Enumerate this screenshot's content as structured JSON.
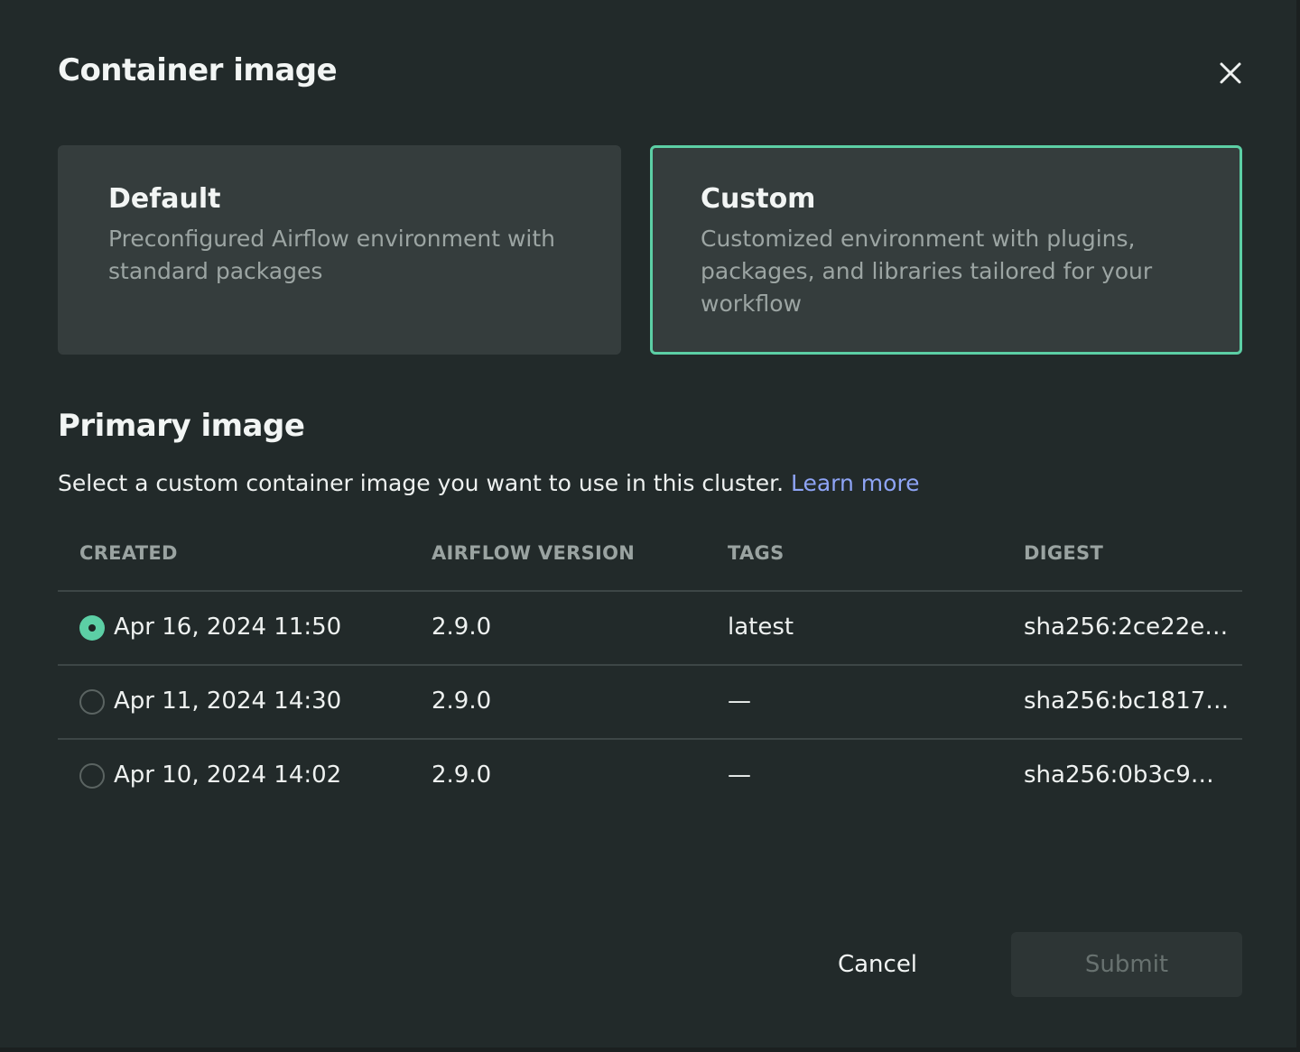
{
  "dialog": {
    "title": "Container image",
    "close_icon": "close-icon"
  },
  "options": [
    {
      "title": "Default",
      "description": "Preconfigured Airflow environment with standard packages",
      "selected": false
    },
    {
      "title": "Custom",
      "description": "Customized environment with plugins, packages, and libraries tailored for your workflow",
      "selected": true
    }
  ],
  "primary": {
    "title": "Primary image",
    "description": "Select a custom container image you want to use in this cluster.",
    "learn_more": "Learn more"
  },
  "table": {
    "headers": {
      "created": "CREATED",
      "version": "AIRFLOW VERSION",
      "tags": "TAGS",
      "digest": "DIGEST"
    },
    "rows": [
      {
        "created": "Apr 16, 2024 11:50",
        "version": "2.9.0",
        "tags": "latest",
        "digest": "sha256:2ce22e…",
        "selected": true
      },
      {
        "created": "Apr 11, 2024 14:30",
        "version": "2.9.0",
        "tags": "—",
        "digest": "sha256:bc1817…",
        "selected": false
      },
      {
        "created": "Apr 10, 2024 14:02",
        "version": "2.9.0",
        "tags": "—",
        "digest": "sha256:0b3c9…",
        "selected": false
      }
    ]
  },
  "footer": {
    "cancel_label": "Cancel",
    "submit_label": "Submit"
  },
  "colors": {
    "background": "#222a2a",
    "card": "#353d3d",
    "accent": "#5ccfa5",
    "link": "#8ea4f5"
  }
}
